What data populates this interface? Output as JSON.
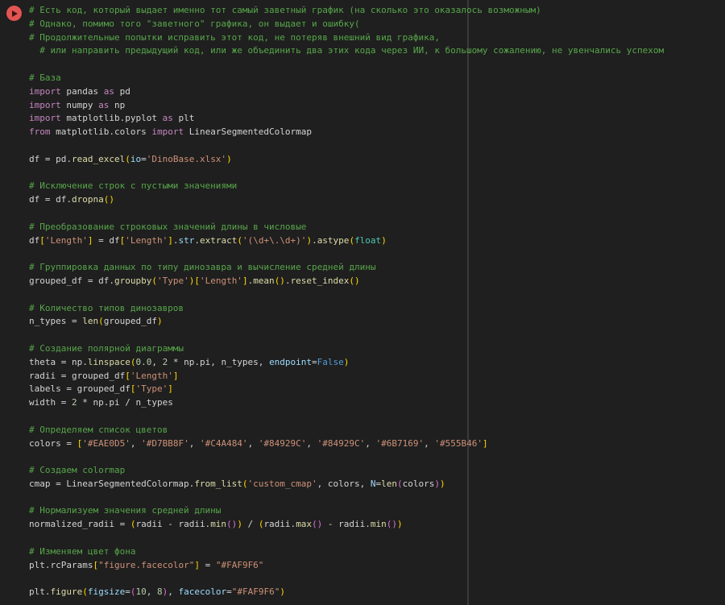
{
  "editor": {
    "background": "#1f1f1f",
    "ruler_color": "#3a3a3a",
    "run_button": {
      "color": "#e25552",
      "icon_color": "#3f1111",
      "icon": "play-icon"
    },
    "token_colors": {
      "c": "#57A64A",
      "k": "#C586C0",
      "s": "#CE9178",
      "f": "#DCDCAA",
      "v": "#9CDCFE",
      "n": "#B5CEA8",
      "t": "#4EC9B0",
      "b": "#569CD6",
      "p1": "#FFD700",
      "p2": "#DA70D6",
      "w": "#D4D4D4"
    },
    "lines": [
      [
        [
          "c",
          "# Есть код, который выдает именно тот самый заветный график (на сколько это оказалось возможным)"
        ]
      ],
      [
        [
          "c",
          "# Однако, помимо того \"заветного\" графика, он выдает и ошибку("
        ]
      ],
      [
        [
          "c",
          "# Продолжительные попытки исправить этот код, не потеряв внешний вид графика,"
        ]
      ],
      [
        [
          "c",
          "  # или направить предыдущий код, или же объединить два этих кода через ИИ, к большому сожалению, не увенчались успехом"
        ]
      ],
      [],
      [
        [
          "c",
          "# База"
        ]
      ],
      [
        [
          "k",
          "import"
        ],
        [
          "w",
          " pandas "
        ],
        [
          "k",
          "as"
        ],
        [
          "w",
          " pd"
        ]
      ],
      [
        [
          "k",
          "import"
        ],
        [
          "w",
          " numpy "
        ],
        [
          "k",
          "as"
        ],
        [
          "w",
          " np"
        ]
      ],
      [
        [
          "k",
          "import"
        ],
        [
          "w",
          " matplotlib.pyplot "
        ],
        [
          "k",
          "as"
        ],
        [
          "w",
          " plt"
        ]
      ],
      [
        [
          "k",
          "from"
        ],
        [
          "w",
          " matplotlib.colors "
        ],
        [
          "k",
          "import"
        ],
        [
          "w",
          " LinearSegmentedColormap"
        ]
      ],
      [],
      [
        [
          "w",
          "df = pd."
        ],
        [
          "f",
          "read_excel"
        ],
        [
          "p1",
          "("
        ],
        [
          "v",
          "io"
        ],
        [
          "w",
          "="
        ],
        [
          "s",
          "'DinoBase.xlsx'"
        ],
        [
          "p1",
          ")"
        ]
      ],
      [],
      [
        [
          "c",
          "# Исключение строк с пустыми значениями"
        ]
      ],
      [
        [
          "w",
          "df = df."
        ],
        [
          "f",
          "dropna"
        ],
        [
          "p1",
          "()"
        ]
      ],
      [],
      [
        [
          "c",
          "# Преобразование строковых значений длины в числовые"
        ]
      ],
      [
        [
          "w",
          "df"
        ],
        [
          "p1",
          "["
        ],
        [
          "s",
          "'Length'"
        ],
        [
          "p1",
          "]"
        ],
        [
          "w",
          " = df"
        ],
        [
          "p1",
          "["
        ],
        [
          "s",
          "'Length'"
        ],
        [
          "p1",
          "]"
        ],
        [
          "w",
          "."
        ],
        [
          "v",
          "str"
        ],
        [
          "w",
          "."
        ],
        [
          "f",
          "extract"
        ],
        [
          "p1",
          "("
        ],
        [
          "s",
          "'(\\d+\\.\\d+)'"
        ],
        [
          "p1",
          ")"
        ],
        [
          "w",
          "."
        ],
        [
          "f",
          "astype"
        ],
        [
          "p1",
          "("
        ],
        [
          "t",
          "float"
        ],
        [
          "p1",
          ")"
        ]
      ],
      [],
      [
        [
          "c",
          "# Группировка данных по типу динозавра и вычисление средней длины"
        ]
      ],
      [
        [
          "w",
          "grouped_df = df."
        ],
        [
          "f",
          "groupby"
        ],
        [
          "p1",
          "("
        ],
        [
          "s",
          "'Type'"
        ],
        [
          "p1",
          ")["
        ],
        [
          "s",
          "'Length'"
        ],
        [
          "p1",
          "]"
        ],
        [
          "w",
          "."
        ],
        [
          "f",
          "mean"
        ],
        [
          "p1",
          "()"
        ],
        [
          "w",
          "."
        ],
        [
          "f",
          "reset_index"
        ],
        [
          "p1",
          "()"
        ]
      ],
      [],
      [
        [
          "c",
          "# Количество типов динозавров"
        ]
      ],
      [
        [
          "w",
          "n_types = "
        ],
        [
          "f",
          "len"
        ],
        [
          "p1",
          "("
        ],
        [
          "w",
          "grouped_df"
        ],
        [
          "p1",
          ")"
        ]
      ],
      [],
      [
        [
          "c",
          "# Создание полярной диаграммы"
        ]
      ],
      [
        [
          "w",
          "theta = np."
        ],
        [
          "f",
          "linspace"
        ],
        [
          "p1",
          "("
        ],
        [
          "n",
          "0.0"
        ],
        [
          "w",
          ", "
        ],
        [
          "n",
          "2"
        ],
        [
          "w",
          " * np.pi, n_types, "
        ],
        [
          "v",
          "endpoint"
        ],
        [
          "w",
          "="
        ],
        [
          "b",
          "False"
        ],
        [
          "p1",
          ")"
        ]
      ],
      [
        [
          "w",
          "radii = grouped_df"
        ],
        [
          "p1",
          "["
        ],
        [
          "s",
          "'Length'"
        ],
        [
          "p1",
          "]"
        ]
      ],
      [
        [
          "w",
          "labels = grouped_df"
        ],
        [
          "p1",
          "["
        ],
        [
          "s",
          "'Type'"
        ],
        [
          "p1",
          "]"
        ]
      ],
      [
        [
          "w",
          "width = "
        ],
        [
          "n",
          "2"
        ],
        [
          "w",
          " * np.pi / n_types"
        ]
      ],
      [],
      [
        [
          "c",
          "# Определяем список цветов"
        ]
      ],
      [
        [
          "w",
          "colors = "
        ],
        [
          "p1",
          "["
        ],
        [
          "s",
          "'#EAE0D5'"
        ],
        [
          "w",
          ", "
        ],
        [
          "s",
          "'#D7BB8F'"
        ],
        [
          "w",
          ", "
        ],
        [
          "s",
          "'#C4A484'"
        ],
        [
          "w",
          ", "
        ],
        [
          "s",
          "'#84929C'"
        ],
        [
          "w",
          ", "
        ],
        [
          "s",
          "'#84929C'"
        ],
        [
          "w",
          ", "
        ],
        [
          "s",
          "'#6B7169'"
        ],
        [
          "w",
          ", "
        ],
        [
          "s",
          "'#555B46'"
        ],
        [
          "p1",
          "]"
        ]
      ],
      [],
      [
        [
          "c",
          "# Создаем colormap"
        ]
      ],
      [
        [
          "w",
          "cmap = LinearSegmentedColormap."
        ],
        [
          "f",
          "from_list"
        ],
        [
          "p1",
          "("
        ],
        [
          "s",
          "'custom_cmap'"
        ],
        [
          "w",
          ", colors, "
        ],
        [
          "v",
          "N"
        ],
        [
          "w",
          "="
        ],
        [
          "f",
          "len"
        ],
        [
          "p2",
          "("
        ],
        [
          "w",
          "colors"
        ],
        [
          "p2",
          ")"
        ],
        [
          "p1",
          ")"
        ]
      ],
      [],
      [
        [
          "c",
          "# Нормализуем значения средней длины"
        ]
      ],
      [
        [
          "w",
          "normalized_radii = "
        ],
        [
          "p1",
          "("
        ],
        [
          "w",
          "radii - radii."
        ],
        [
          "f",
          "min"
        ],
        [
          "p2",
          "()"
        ],
        [
          "p1",
          ")"
        ],
        [
          "w",
          " / "
        ],
        [
          "p1",
          "("
        ],
        [
          "w",
          "radii."
        ],
        [
          "f",
          "max"
        ],
        [
          "p2",
          "()"
        ],
        [
          "w",
          " - radii."
        ],
        [
          "f",
          "min"
        ],
        [
          "p2",
          "()"
        ],
        [
          "p1",
          ")"
        ]
      ],
      [],
      [
        [
          "c",
          "# Изменяем цвет фона"
        ]
      ],
      [
        [
          "w",
          "plt.rcParams"
        ],
        [
          "p1",
          "["
        ],
        [
          "s",
          "\"figure.facecolor\""
        ],
        [
          "p1",
          "]"
        ],
        [
          "w",
          " = "
        ],
        [
          "s",
          "\"#FAF9F6\""
        ]
      ],
      [],
      [
        [
          "w",
          "plt."
        ],
        [
          "f",
          "figure"
        ],
        [
          "p1",
          "("
        ],
        [
          "v",
          "figsize"
        ],
        [
          "w",
          "="
        ],
        [
          "p2",
          "("
        ],
        [
          "n",
          "10"
        ],
        [
          "w",
          ", "
        ],
        [
          "n",
          "8"
        ],
        [
          "p2",
          ")"
        ],
        [
          "w",
          ", "
        ],
        [
          "v",
          "facecolor"
        ],
        [
          "w",
          "="
        ],
        [
          "s",
          "\"#FAF9F6\""
        ],
        [
          "p1",
          ")"
        ]
      ]
    ]
  }
}
